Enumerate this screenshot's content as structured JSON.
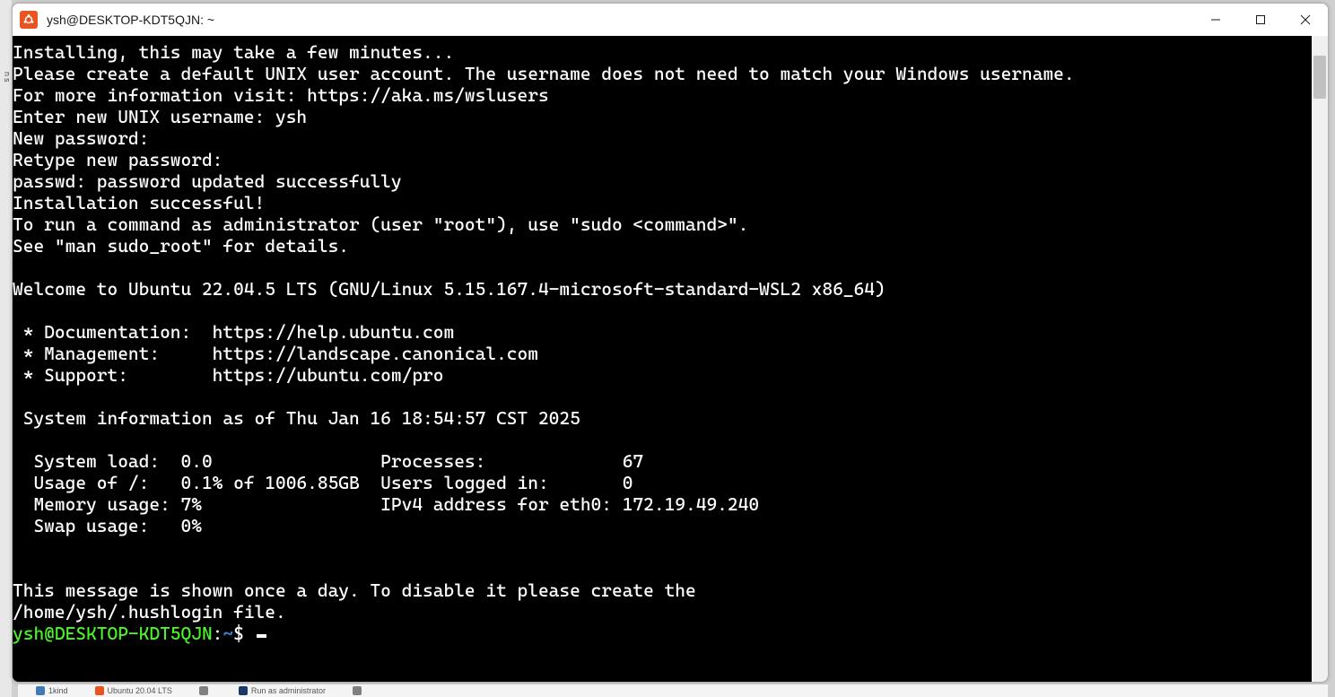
{
  "edge_hint": "ns",
  "title": "ysh@DESKTOP-KDT5QJN: ~",
  "terminal": {
    "lines": [
      "Installing, this may take a few minutes...",
      "Please create a default UNIX user account. The username does not need to match your Windows username.",
      "For more information visit: https://aka.ms/wslusers",
      "Enter new UNIX username: ysh",
      "New password:",
      "Retype new password:",
      "passwd: password updated successfully",
      "Installation successful!",
      "To run a command as administrator (user \"root\"), use \"sudo <command>\".",
      "See \"man sudo_root\" for details.",
      "",
      "Welcome to Ubuntu 22.04.5 LTS (GNU/Linux 5.15.167.4-microsoft-standard-WSL2 x86_64)",
      "",
      " * Documentation:  https://help.ubuntu.com",
      " * Management:     https://landscape.canonical.com",
      " * Support:        https://ubuntu.com/pro",
      "",
      " System information as of Thu Jan 16 18:54:57 CST 2025",
      "",
      "  System load:  0.0                Processes:             67",
      "  Usage of /:   0.1% of 1006.85GB  Users logged in:       0",
      "  Memory usage: 7%                 IPv4 address for eth0: 172.19.49.240",
      "  Swap usage:   0%",
      "",
      "",
      "This message is shown once a day. To disable it please create the",
      "/home/ysh/.hushlogin file."
    ],
    "prompt_user": "ysh@DESKTOP-KDT5QJN",
    "prompt_sep": ":",
    "prompt_path": "~",
    "prompt_symbol": "$ "
  },
  "taskbar": {
    "items": [
      {
        "icon": "blue",
        "label": "1kind"
      },
      {
        "icon": "orange",
        "label": "Ubuntu 20.04 LTS"
      },
      {
        "icon": "grey",
        "label": ""
      },
      {
        "icon": "darkblue",
        "label": "Run as administrator"
      },
      {
        "icon": "grey",
        "label": ""
      }
    ]
  }
}
